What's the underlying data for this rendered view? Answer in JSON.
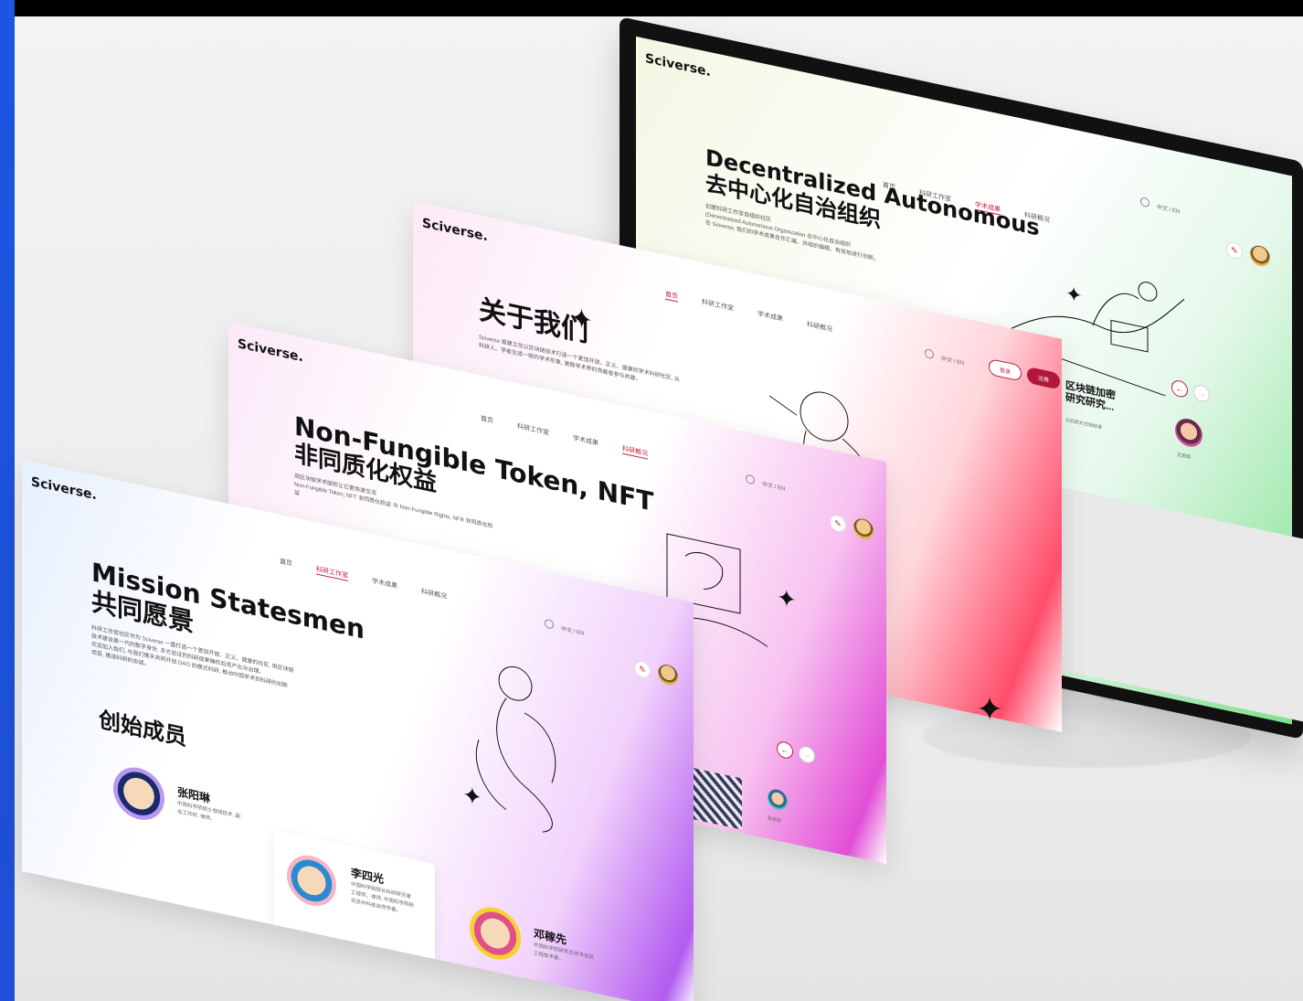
{
  "brand": "Sciverse.",
  "monitor_page": {
    "nav": [
      "首页",
      "科研工作室",
      "学术成果",
      "科研概况"
    ],
    "nav_active": 2,
    "title_en": "Decentralized Autonomous",
    "title_cn": "去中心化自治组织",
    "lines": [
      "创建科研工作室自组织社区",
      "(Decentralized Autonomous Organization 去中心化自治组织",
      "在 Sciverse, 我们的学术成果在作汇编、共组织编辑、有效地进行创新。"
    ],
    "lang": "中文 / EN",
    "snippet_title": "区块链加密\n研究研究...",
    "snippet_sub": "以后的方式组标准",
    "snippet_name": "王思雨"
  },
  "about_page": {
    "nav": [
      "首页",
      "科研工作室",
      "学术成果",
      "科研概况"
    ],
    "nav_active": 0,
    "title": "关于我们",
    "lines": [
      "Sciverse 是建立在以区块链技术打造一个更加开放、正义、健康的学术科研社区, 从",
      "科研人、学者生成一般的学术形象, 激励学术界的贡献者参与共建。"
    ],
    "lang": "中文 / EN",
    "login": "登录",
    "register": "注册"
  },
  "nft_page": {
    "nav": [
      "首页",
      "科研工作室",
      "学术成果",
      "科研概况"
    ],
    "nav_active": 3,
    "title_en": "Non-Fungible Token, NFT",
    "title_cn": "非同质化权益",
    "lines": [
      "用区块链学术版权让它更快速交流",
      "Non-Fungible Token, NFT 非同质化权益 与 Non-Fungible Rights, NFR 非同质化权",
      "益"
    ],
    "lang": "中文 / EN",
    "member_name": "张思雨"
  },
  "mission_page": {
    "nav": [
      "首页",
      "科研工作室",
      "学术成果",
      "科研概况"
    ],
    "nav_active": 1,
    "title_en": "Mission Statesmen",
    "title_cn": "共同愿景",
    "lines": [
      "科研工作室社区作为 Sciverse 一直打造一个更加开放、正义、健康的社区, 用区块链",
      "技术建设第一代的数字身份, 多方验证的科研成果确权后资产化与治理。",
      "欢迎加入我们, 与我们携手共同开创 DAO 的模式科研, 推动中国学术到科研的创新",
      "项目, 推进科研的协调。"
    ],
    "lang": "中文 / EN",
    "section_title": "创始成员",
    "members": [
      {
        "name": "张阳琳",
        "desc": "中国科学院院士领域技术, 副会工作时, 律师。"
      },
      {
        "name": "李四光",
        "desc": "中国科学院院长科研研究者工程师、律师, 中国科学院研究员中科技自然学者。"
      },
      {
        "name": "邓稼先",
        "desc": "中国科学院研究员学术会员工程技术者。"
      }
    ]
  }
}
